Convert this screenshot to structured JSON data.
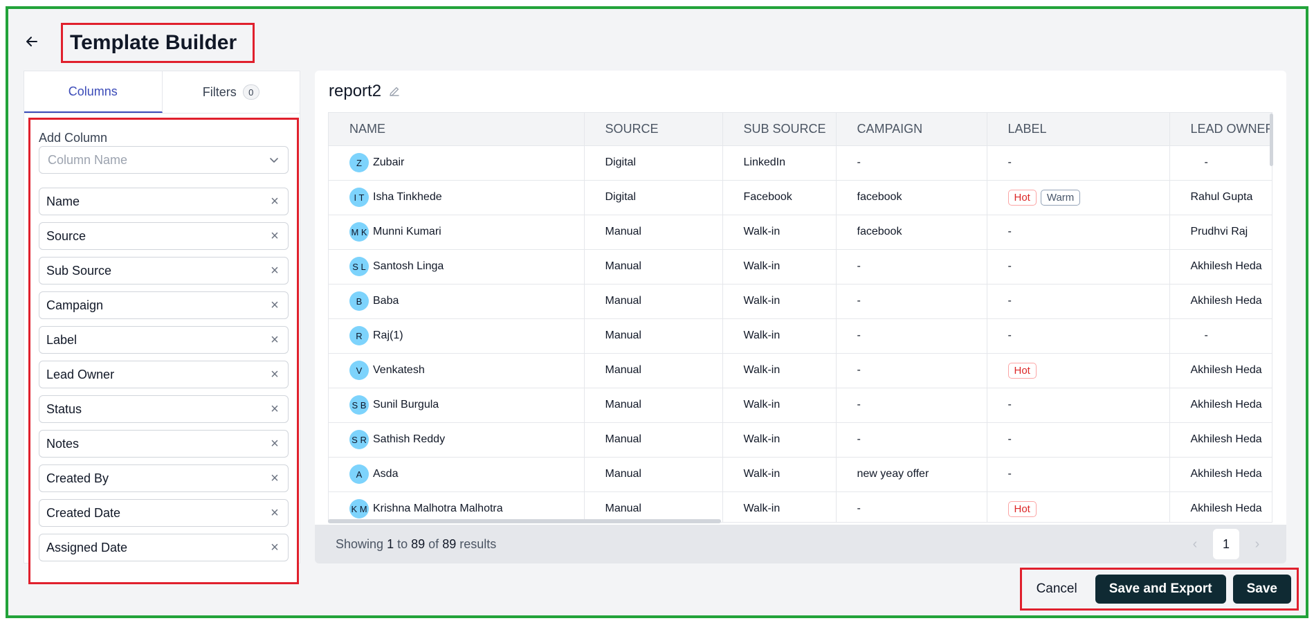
{
  "header": {
    "title": "Template Builder",
    "back_icon": "arrow-left-icon"
  },
  "left_panel": {
    "tabs": [
      {
        "label": "Columns",
        "active": true
      },
      {
        "label": "Filters",
        "count": "0",
        "active": false
      }
    ],
    "add_column_label": "Add Column",
    "column_select_placeholder": "Column Name",
    "columns": [
      {
        "label": "Name"
      },
      {
        "label": "Source"
      },
      {
        "label": "Sub Source"
      },
      {
        "label": "Campaign"
      },
      {
        "label": "Label"
      },
      {
        "label": "Lead Owner"
      },
      {
        "label": "Status"
      },
      {
        "label": "Notes"
      },
      {
        "label": "Created By"
      },
      {
        "label": "Created Date"
      },
      {
        "label": "Assigned Date"
      }
    ]
  },
  "report": {
    "name": "report2",
    "headers": [
      "NAME",
      "SOURCE",
      "SUB SOURCE",
      "CAMPAIGN",
      "LABEL",
      "LEAD OWNER"
    ],
    "rows": [
      {
        "initials": "Z",
        "name": "Zubair",
        "source": "Digital",
        "sub_source": "LinkedIn",
        "campaign": "-",
        "labels": [],
        "label_text": "-",
        "owner": "-"
      },
      {
        "initials": "I T",
        "name": "Isha Tinkhede",
        "source": "Digital",
        "sub_source": "Facebook",
        "campaign": "facebook",
        "labels": [
          {
            "text": "Hot",
            "kind": "hot"
          },
          {
            "text": "Warm",
            "kind": "warm"
          }
        ],
        "label_text": "",
        "owner": "Rahul Gupta"
      },
      {
        "initials": "M K",
        "name": "Munni Kumari",
        "source": "Manual",
        "sub_source": "Walk-in",
        "campaign": "facebook",
        "labels": [],
        "label_text": "-",
        "owner": "Prudhvi Raj"
      },
      {
        "initials": "S L",
        "name": "Santosh Linga",
        "source": "Manual",
        "sub_source": "Walk-in",
        "campaign": "-",
        "labels": [],
        "label_text": "-",
        "owner": "Akhilesh Heda"
      },
      {
        "initials": "B",
        "name": "Baba",
        "source": "Manual",
        "sub_source": "Walk-in",
        "campaign": "-",
        "labels": [],
        "label_text": "-",
        "owner": "Akhilesh Heda"
      },
      {
        "initials": "R",
        "name": "Raj(1)",
        "source": "Manual",
        "sub_source": "Walk-in",
        "campaign": "-",
        "labels": [],
        "label_text": "-",
        "owner": "-"
      },
      {
        "initials": "V",
        "name": "Venkatesh",
        "source": "Manual",
        "sub_source": "Walk-in",
        "campaign": "-",
        "labels": [
          {
            "text": "Hot",
            "kind": "hot"
          }
        ],
        "label_text": "",
        "owner": "Akhilesh Heda"
      },
      {
        "initials": "S B",
        "name": "Sunil Burgula",
        "source": "Manual",
        "sub_source": "Walk-in",
        "campaign": "-",
        "labels": [],
        "label_text": "-",
        "owner": "Akhilesh Heda"
      },
      {
        "initials": "S R",
        "name": "Sathish Reddy",
        "source": "Manual",
        "sub_source": "Walk-in",
        "campaign": "-",
        "labels": [],
        "label_text": "-",
        "owner": "Akhilesh Heda"
      },
      {
        "initials": "A",
        "name": "Asda",
        "source": "Manual",
        "sub_source": "Walk-in",
        "campaign": "new yeay offer",
        "labels": [],
        "label_text": "-",
        "owner": "Akhilesh Heda"
      },
      {
        "initials": "K M",
        "name": "Krishna Malhotra Malhotra",
        "source": "Manual",
        "sub_source": "Walk-in",
        "campaign": "-",
        "labels": [
          {
            "text": "Hot",
            "kind": "hot"
          }
        ],
        "label_text": "",
        "owner": "Akhilesh Heda"
      }
    ]
  },
  "pagination": {
    "prefix": "Showing",
    "from": "1",
    "to_word": "to",
    "to": "89",
    "of_word": "of",
    "total": "89",
    "suffix": "results",
    "current_page": "1"
  },
  "actions": {
    "cancel": "Cancel",
    "save_and_export": "Save and Export",
    "save": "Save"
  },
  "colors": {
    "accent": "#3b4bb8",
    "dark_button": "#0f2a33",
    "avatar": "#7dd3fc",
    "hot": "#dc2626",
    "highlight_red": "#e0202d",
    "frame_green": "#22a33a"
  }
}
